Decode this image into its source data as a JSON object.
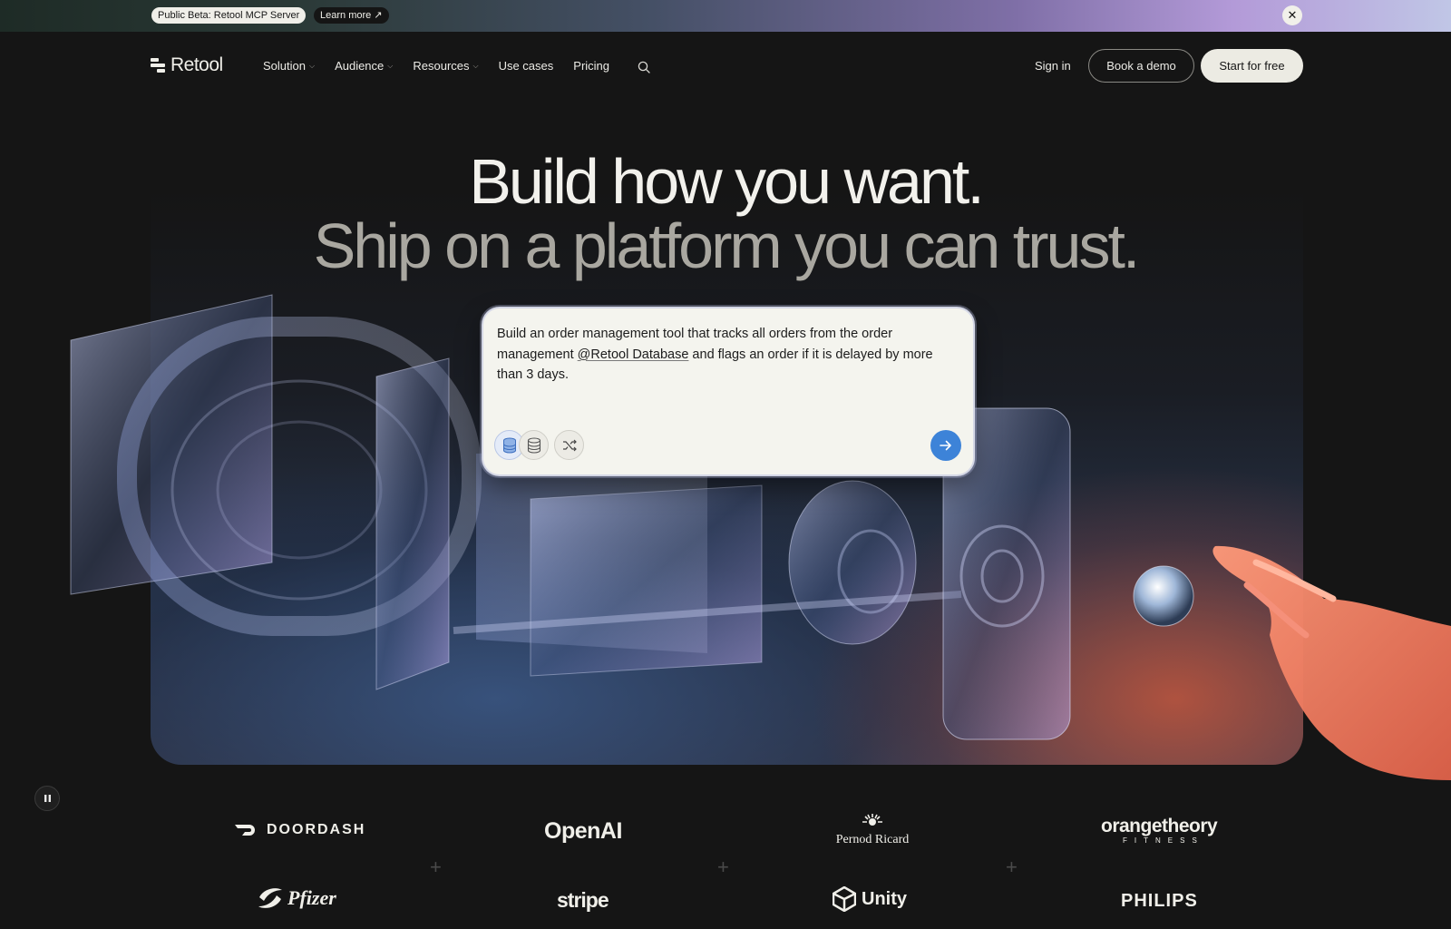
{
  "announcement": {
    "badge": "Public Beta: Retool MCP Server",
    "learn_more": "Learn more ↗",
    "close_icon": "close-icon"
  },
  "nav": {
    "logo_text": "Retool",
    "links": [
      {
        "label": "Solution",
        "has_dropdown": true
      },
      {
        "label": "Audience",
        "has_dropdown": true
      },
      {
        "label": "Resources",
        "has_dropdown": true
      },
      {
        "label": "Use cases",
        "has_dropdown": false
      },
      {
        "label": "Pricing",
        "has_dropdown": false
      }
    ],
    "search_icon": "search-icon",
    "sign_in": "Sign in",
    "book_demo": "Book a demo",
    "start_free": "Start for free"
  },
  "hero": {
    "title_line1": "Build how you want.",
    "title_line2": "Ship on a platform you can trust."
  },
  "prompt": {
    "text_before": "Build an order management tool that tracks all orders from the order management ",
    "mention": "@Retool Database",
    "text_after": " and flags an order if it is delayed by more than 3 days.",
    "tools": [
      "database-icon-active",
      "database-icon",
      "shuffle-icon"
    ],
    "send_icon": "arrow-right-icon"
  },
  "controls": {
    "pause_icon": "pause-icon"
  },
  "customer_logos": [
    "DOORDASH",
    "OpenAI",
    "Pernod Ricard",
    "orangetheory",
    "FITNESS",
    "Pfizer",
    "stripe",
    "Unity",
    "PHILIPS"
  ],
  "colors": {
    "page_bg": "#151515",
    "cta_bg": "#ecebe3",
    "send_button": "#3d83d8",
    "prompt_card": "#f4f4ee"
  }
}
